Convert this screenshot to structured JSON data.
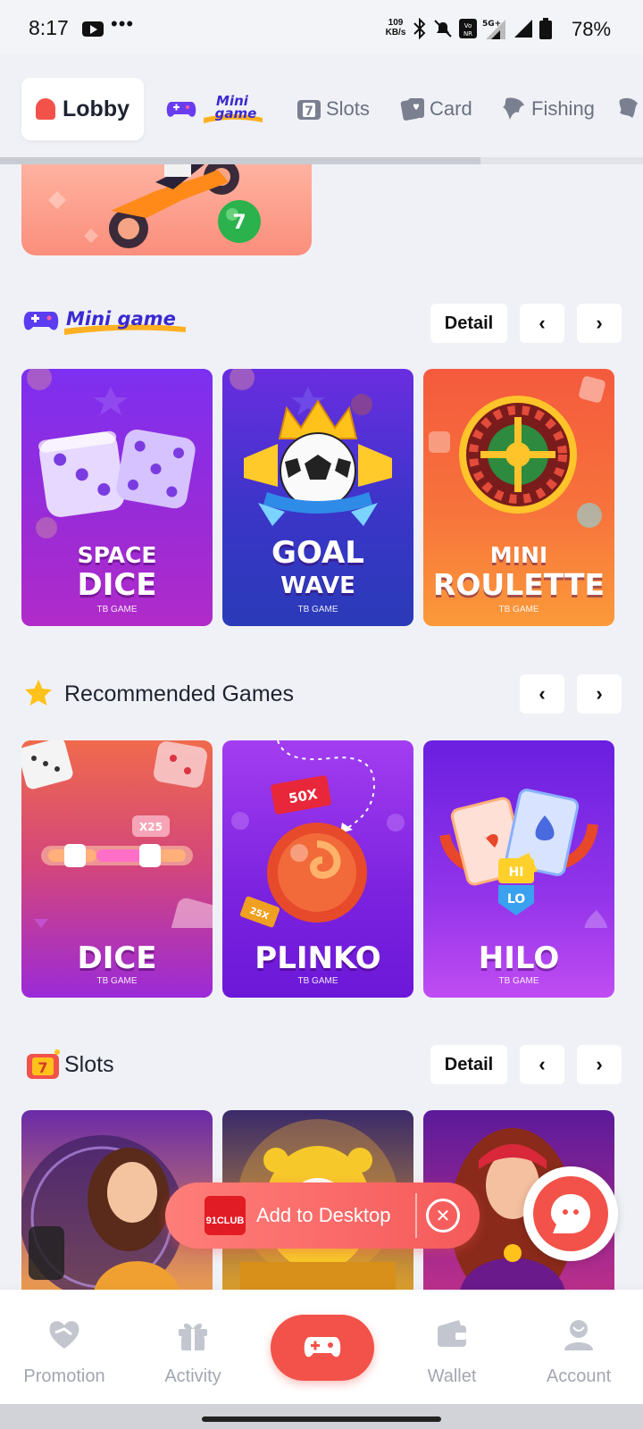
{
  "status_bar": {
    "time": "8:17",
    "more": "•••",
    "net_speed_value": "109",
    "net_speed_unit": "KB/s",
    "battery": "78%"
  },
  "categories": [
    {
      "label": "Lobby"
    },
    {
      "label": "Mini game"
    },
    {
      "label": "Slots"
    },
    {
      "label": "Card"
    },
    {
      "label": "Fishing"
    }
  ],
  "sections": {
    "mini_game": {
      "title": "Mini game",
      "detail_label": "Detail",
      "prev": "‹",
      "next": "›",
      "games": [
        {
          "line1": "SPACE",
          "line2": "DICE",
          "provider": "TB GAME"
        },
        {
          "line1": "GOAL",
          "line2": "WAVE",
          "provider": "TB GAME"
        },
        {
          "line1": "MINI",
          "line2": "ROULETTE",
          "provider": "TB GAME"
        }
      ]
    },
    "recommended": {
      "title": "Recommended Games",
      "prev": "‹",
      "next": "›",
      "games": [
        {
          "line1": "",
          "line2": "DICE",
          "provider": "TB GAME",
          "badge": "X25"
        },
        {
          "line1": "",
          "line2": "PLINKO",
          "provider": "TB GAME",
          "badge": "50X",
          "badge2": "25X"
        },
        {
          "line1": "",
          "line2": "HILO",
          "provider": "TB GAME",
          "hi": "HI",
          "lo": "LO"
        }
      ]
    },
    "slots": {
      "title": "Slots",
      "detail_label": "Detail",
      "prev": "‹",
      "next": "›"
    }
  },
  "add_to_desktop": {
    "logo_text": "91CLUB",
    "label": "Add to Desktop",
    "close": "✕"
  },
  "bottom_nav": [
    {
      "label": "Promotion"
    },
    {
      "label": "Activity"
    },
    {
      "label": ""
    },
    {
      "label": "Wallet"
    },
    {
      "label": "Account"
    }
  ],
  "colors": {
    "accent": "#f2524a",
    "background": "#f0f1f6",
    "inactive": "#a3a6b0"
  }
}
